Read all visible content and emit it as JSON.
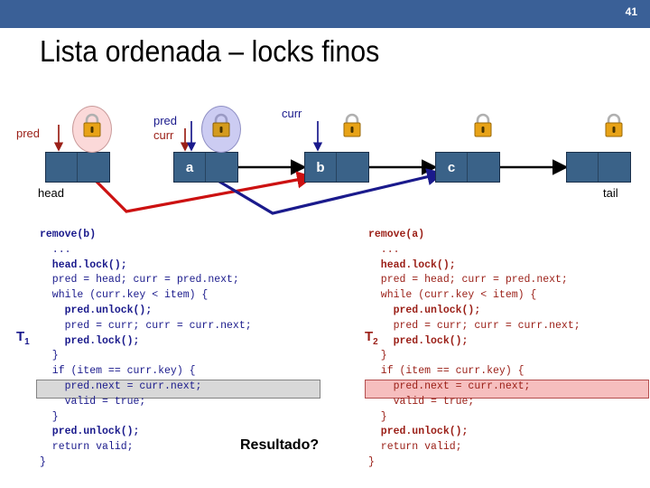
{
  "header": {
    "slide_number": "41",
    "bar_color": "#3a6097"
  },
  "title": "Lista ordenada – locks finos",
  "diagram": {
    "nodes": [
      {
        "label": "",
        "end_label": "head"
      },
      {
        "label": "a",
        "end_label": ""
      },
      {
        "label": "b",
        "end_label": ""
      },
      {
        "label": "c",
        "end_label": ""
      },
      {
        "label": "",
        "end_label": "tail"
      }
    ],
    "pointer_labels": [
      {
        "text": "pred",
        "color": "#9b2018",
        "target": "head"
      },
      {
        "text": "pred",
        "color": "#1a1a8c",
        "target": "a"
      },
      {
        "text": "curr",
        "color": "#9b2018",
        "target": "a"
      },
      {
        "text": "curr",
        "color": "#1a1a8c",
        "target": "b"
      }
    ],
    "locks": [
      {
        "halo": "pink",
        "over": "head"
      },
      {
        "halo": "blue",
        "over": "a"
      },
      {
        "halo": "none",
        "over": "b"
      },
      {
        "halo": "none",
        "over": "c"
      },
      {
        "halo": "none",
        "over": "tail"
      }
    ],
    "modified_links": [
      {
        "color": "#cc1111",
        "from": "head",
        "to": "b",
        "thread": "T2"
      },
      {
        "color": "#1a1a8c",
        "from": "a",
        "to": "c",
        "thread": "T1"
      }
    ],
    "colors": {
      "node_fill": "#3a6288",
      "node_border": "#1a2f4a",
      "lock_body": "#e8a317",
      "red": "#9b2018",
      "blue": "#1a1a8c"
    }
  },
  "code_left": {
    "thread": "T",
    "thread_sub": "1",
    "color": "#1a1a8c",
    "highlight_color": "#cccccc",
    "lines": [
      {
        "text": "remove(b)",
        "bold": true,
        "indent": 0
      },
      {
        "text": "...",
        "bold": false,
        "indent": 1
      },
      {
        "text": "head.lock();",
        "bold": true,
        "indent": 1
      },
      {
        "text": "pred = head; curr = pred.next;",
        "bold": false,
        "indent": 1
      },
      {
        "text": "while (curr.key < item) {",
        "bold": false,
        "indent": 1
      },
      {
        "text": "pred.unlock();",
        "bold": true,
        "indent": 2
      },
      {
        "text": "pred = curr; curr = curr.next;",
        "bold": false,
        "indent": 2
      },
      {
        "text": "pred.lock();",
        "bold": true,
        "indent": 2
      },
      {
        "text": "}",
        "bold": false,
        "indent": 1
      },
      {
        "text": "if (item == curr.key) {",
        "bold": false,
        "indent": 1
      },
      {
        "text": "pred.next = curr.next;",
        "bold": false,
        "indent": 2
      },
      {
        "text": "valid = true;",
        "bold": false,
        "indent": 2
      },
      {
        "text": "}",
        "bold": false,
        "indent": 1
      },
      {
        "text": "pred.unlock();",
        "bold": true,
        "indent": 1
      },
      {
        "text": "return valid;",
        "bold": false,
        "indent": 1
      },
      {
        "text": "}",
        "bold": false,
        "indent": 0
      }
    ]
  },
  "code_right": {
    "thread": "T",
    "thread_sub": "2",
    "color": "#9b2018",
    "highlight_color": "#f5b3b3",
    "lines": [
      {
        "text": "remove(a)",
        "bold": true,
        "indent": 0
      },
      {
        "text": "...",
        "bold": false,
        "indent": 1
      },
      {
        "text": "head.lock();",
        "bold": true,
        "indent": 1
      },
      {
        "text": "pred = head; curr = pred.next;",
        "bold": false,
        "indent": 1
      },
      {
        "text": "while (curr.key < item) {",
        "bold": false,
        "indent": 1
      },
      {
        "text": "pred.unlock();",
        "bold": true,
        "indent": 2
      },
      {
        "text": "pred = curr; curr = curr.next;",
        "bold": false,
        "indent": 2
      },
      {
        "text": "pred.lock();",
        "bold": true,
        "indent": 2
      },
      {
        "text": "}",
        "bold": false,
        "indent": 1
      },
      {
        "text": "if (item == curr.key) {",
        "bold": false,
        "indent": 1
      },
      {
        "text": "pred.next = curr.next;",
        "bold": false,
        "indent": 2
      },
      {
        "text": "valid = true;",
        "bold": false,
        "indent": 2
      },
      {
        "text": "}",
        "bold": false,
        "indent": 1
      },
      {
        "text": "pred.unlock();",
        "bold": true,
        "indent": 1
      },
      {
        "text": "return valid;",
        "bold": false,
        "indent": 1
      },
      {
        "text": "}",
        "bold": false,
        "indent": 0
      }
    ]
  },
  "question": "Resultado?"
}
